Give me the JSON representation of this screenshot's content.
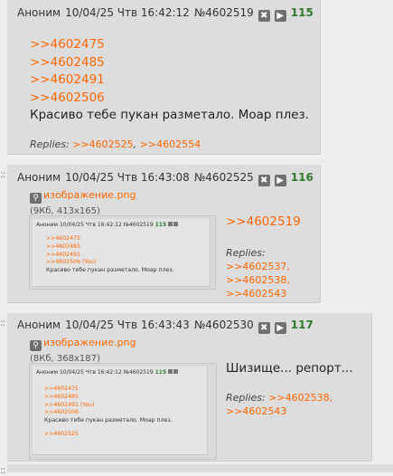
{
  "posts": [
    {
      "name": "Аноним",
      "date": "10/04/25 Чтв 16:42:12",
      "num": "№4602519",
      "replies_count": "115",
      "lines": [
        ">>4602475",
        ">>4602485",
        ">>4602491",
        ">>4602506"
      ],
      "message": "Красиво тебе пукан разметало. Моар плез.",
      "replies_label": "Replies:",
      "replies": [
        ">>4602525",
        ">>4602554"
      ]
    },
    {
      "name": "Аноним",
      "date": "10/04/25 Чтв 16:43:08",
      "num": "№4602525",
      "replies_count": "116",
      "file_name": "изображение.png",
      "file_meta": "(9Кб, 413x165)",
      "lines": [
        ">>4602519"
      ],
      "message": "",
      "replies_label": "Replies:",
      "replies": [
        ">>4602537,",
        ">>4602538,",
        ">>4602543"
      ],
      "thumb": {
        "header": "Аноним 10/04/25 Чтв 16:42:12 №4602519",
        "count": "115",
        "lines": [
          ">>4602475",
          ">>4602485",
          ">>4602491",
          ">>4602506 (You)"
        ],
        "message": "Красиво тебе пукан разметало. Моар плез."
      }
    },
    {
      "name": "Аноним",
      "date": "10/04/25 Чтв 16:43:43",
      "num": "№4602530",
      "replies_count": "117",
      "file_name": "изображение.png",
      "file_meta": "(8Кб, 368x187)",
      "lines": [],
      "message": "Шизище... репорт...",
      "replies_label": "Replies:",
      "replies": [
        ">>4602538,",
        ">>4602543"
      ],
      "thumb": {
        "header": "Аноним 10/04/25 Чтв 16:42:12 №4602519",
        "count": "115",
        "lines": [
          ">>4602475",
          ">>4602485",
          ">>4602491 (You)",
          ">>4602506"
        ],
        "message": "Красиво тебе пукан разметало. Моар плез.",
        "reply": ">>4602525"
      }
    }
  ]
}
